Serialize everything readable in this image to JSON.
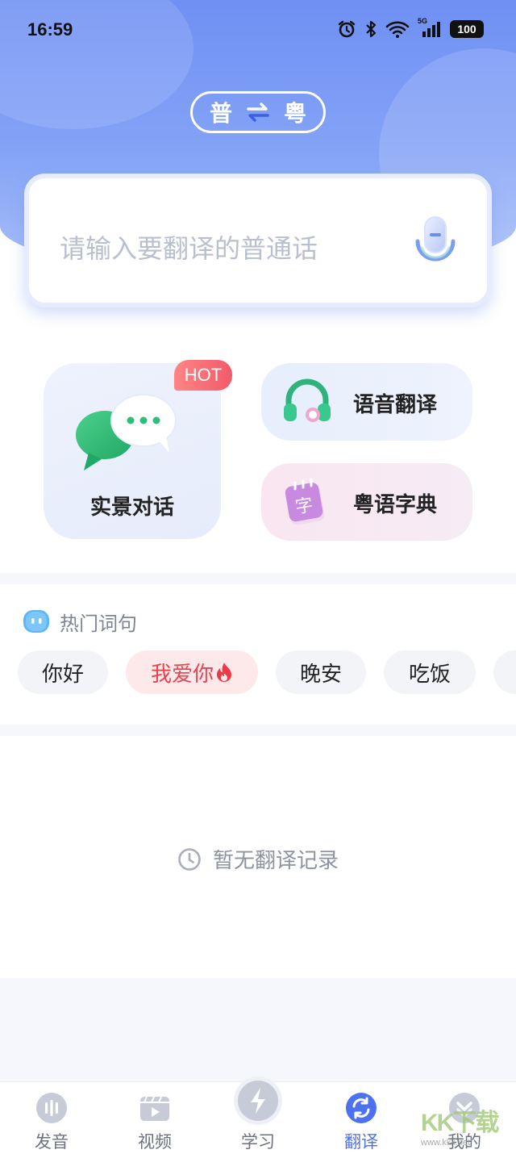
{
  "status_bar": {
    "time": "16:59",
    "network": "5G",
    "battery": "100"
  },
  "lang_switch": {
    "source": "普",
    "target": "粤",
    "icon": "swap-arrows-icon"
  },
  "input": {
    "placeholder": "请输入要翻译的普通话",
    "mic_icon": "microphone-icon"
  },
  "features": {
    "scene_dialog": {
      "label": "实景对话",
      "badge": "HOT"
    },
    "voice_translate": {
      "label": "语音翻译"
    },
    "cantonese_dict": {
      "label": "粤语字典",
      "glyph": "字"
    }
  },
  "hot_phrases": {
    "title": "热门词句",
    "items": [
      "你好",
      "我爱你",
      "晚安",
      "吃饭"
    ],
    "active_index": 1
  },
  "history": {
    "empty_text": "暂无翻译记录"
  },
  "tabs": [
    {
      "label": "发音",
      "icon": "sound-wave-icon"
    },
    {
      "label": "视频",
      "icon": "video-clapper-icon"
    },
    {
      "label": "学习",
      "icon": "lightning-icon"
    },
    {
      "label": "翻译",
      "icon": "translate-refresh-icon",
      "active": true
    },
    {
      "label": "我的",
      "icon": "profile-icon"
    }
  ],
  "watermark": {
    "text": "KK下载",
    "url": "www.kkx.net"
  },
  "colors": {
    "accent": "#4d72f0",
    "hot": "#f25b6a",
    "header": "#7696f4"
  }
}
